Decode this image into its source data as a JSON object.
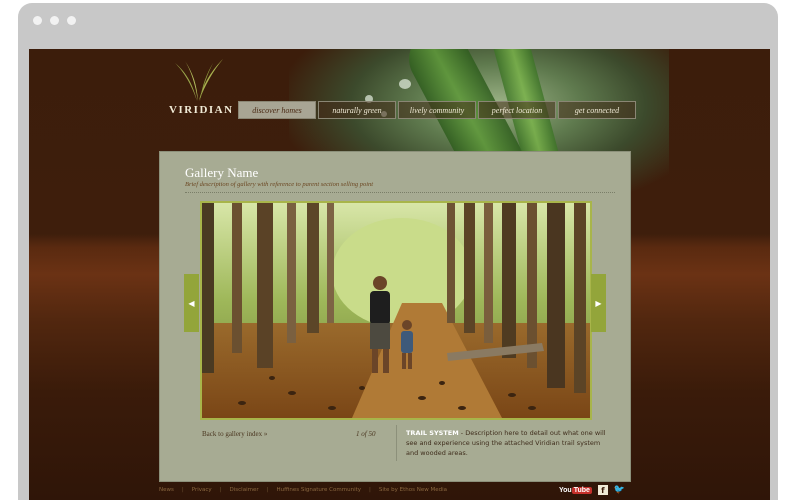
{
  "site": {
    "brand": "VIRIDIAN"
  },
  "nav": [
    {
      "label": "discover homes",
      "active": true
    },
    {
      "label": "naturally green",
      "active": false
    },
    {
      "label": "lively community",
      "active": false
    },
    {
      "label": "perfect location",
      "active": false
    },
    {
      "label": "get connected",
      "active": false
    }
  ],
  "gallery": {
    "title": "Gallery Name",
    "subtitle": "Brief description of gallery with reference to parent section selling point",
    "back_label": "Back to gallery index »",
    "counter": "1 of 50",
    "caption_title": "TRAIL SYSTEM",
    "caption_text": " - Description here to detail out what one will see and experience using the attached Viridian trail system and wooded areas.",
    "prev_icon": "chevron-left-icon",
    "next_icon": "chevron-right-icon"
  },
  "footer": {
    "links": [
      "News",
      "Privacy",
      "Disclaimer",
      "Huffines Signature Community",
      "Site by Ethos New Media"
    ]
  },
  "social": {
    "youtube_you": "You",
    "youtube_tube": "Tube",
    "facebook": "f",
    "twitter": "🐦"
  },
  "colors": {
    "background": "#3c1d0b",
    "panel": "#a7ab93",
    "accent": "#93a53a"
  }
}
